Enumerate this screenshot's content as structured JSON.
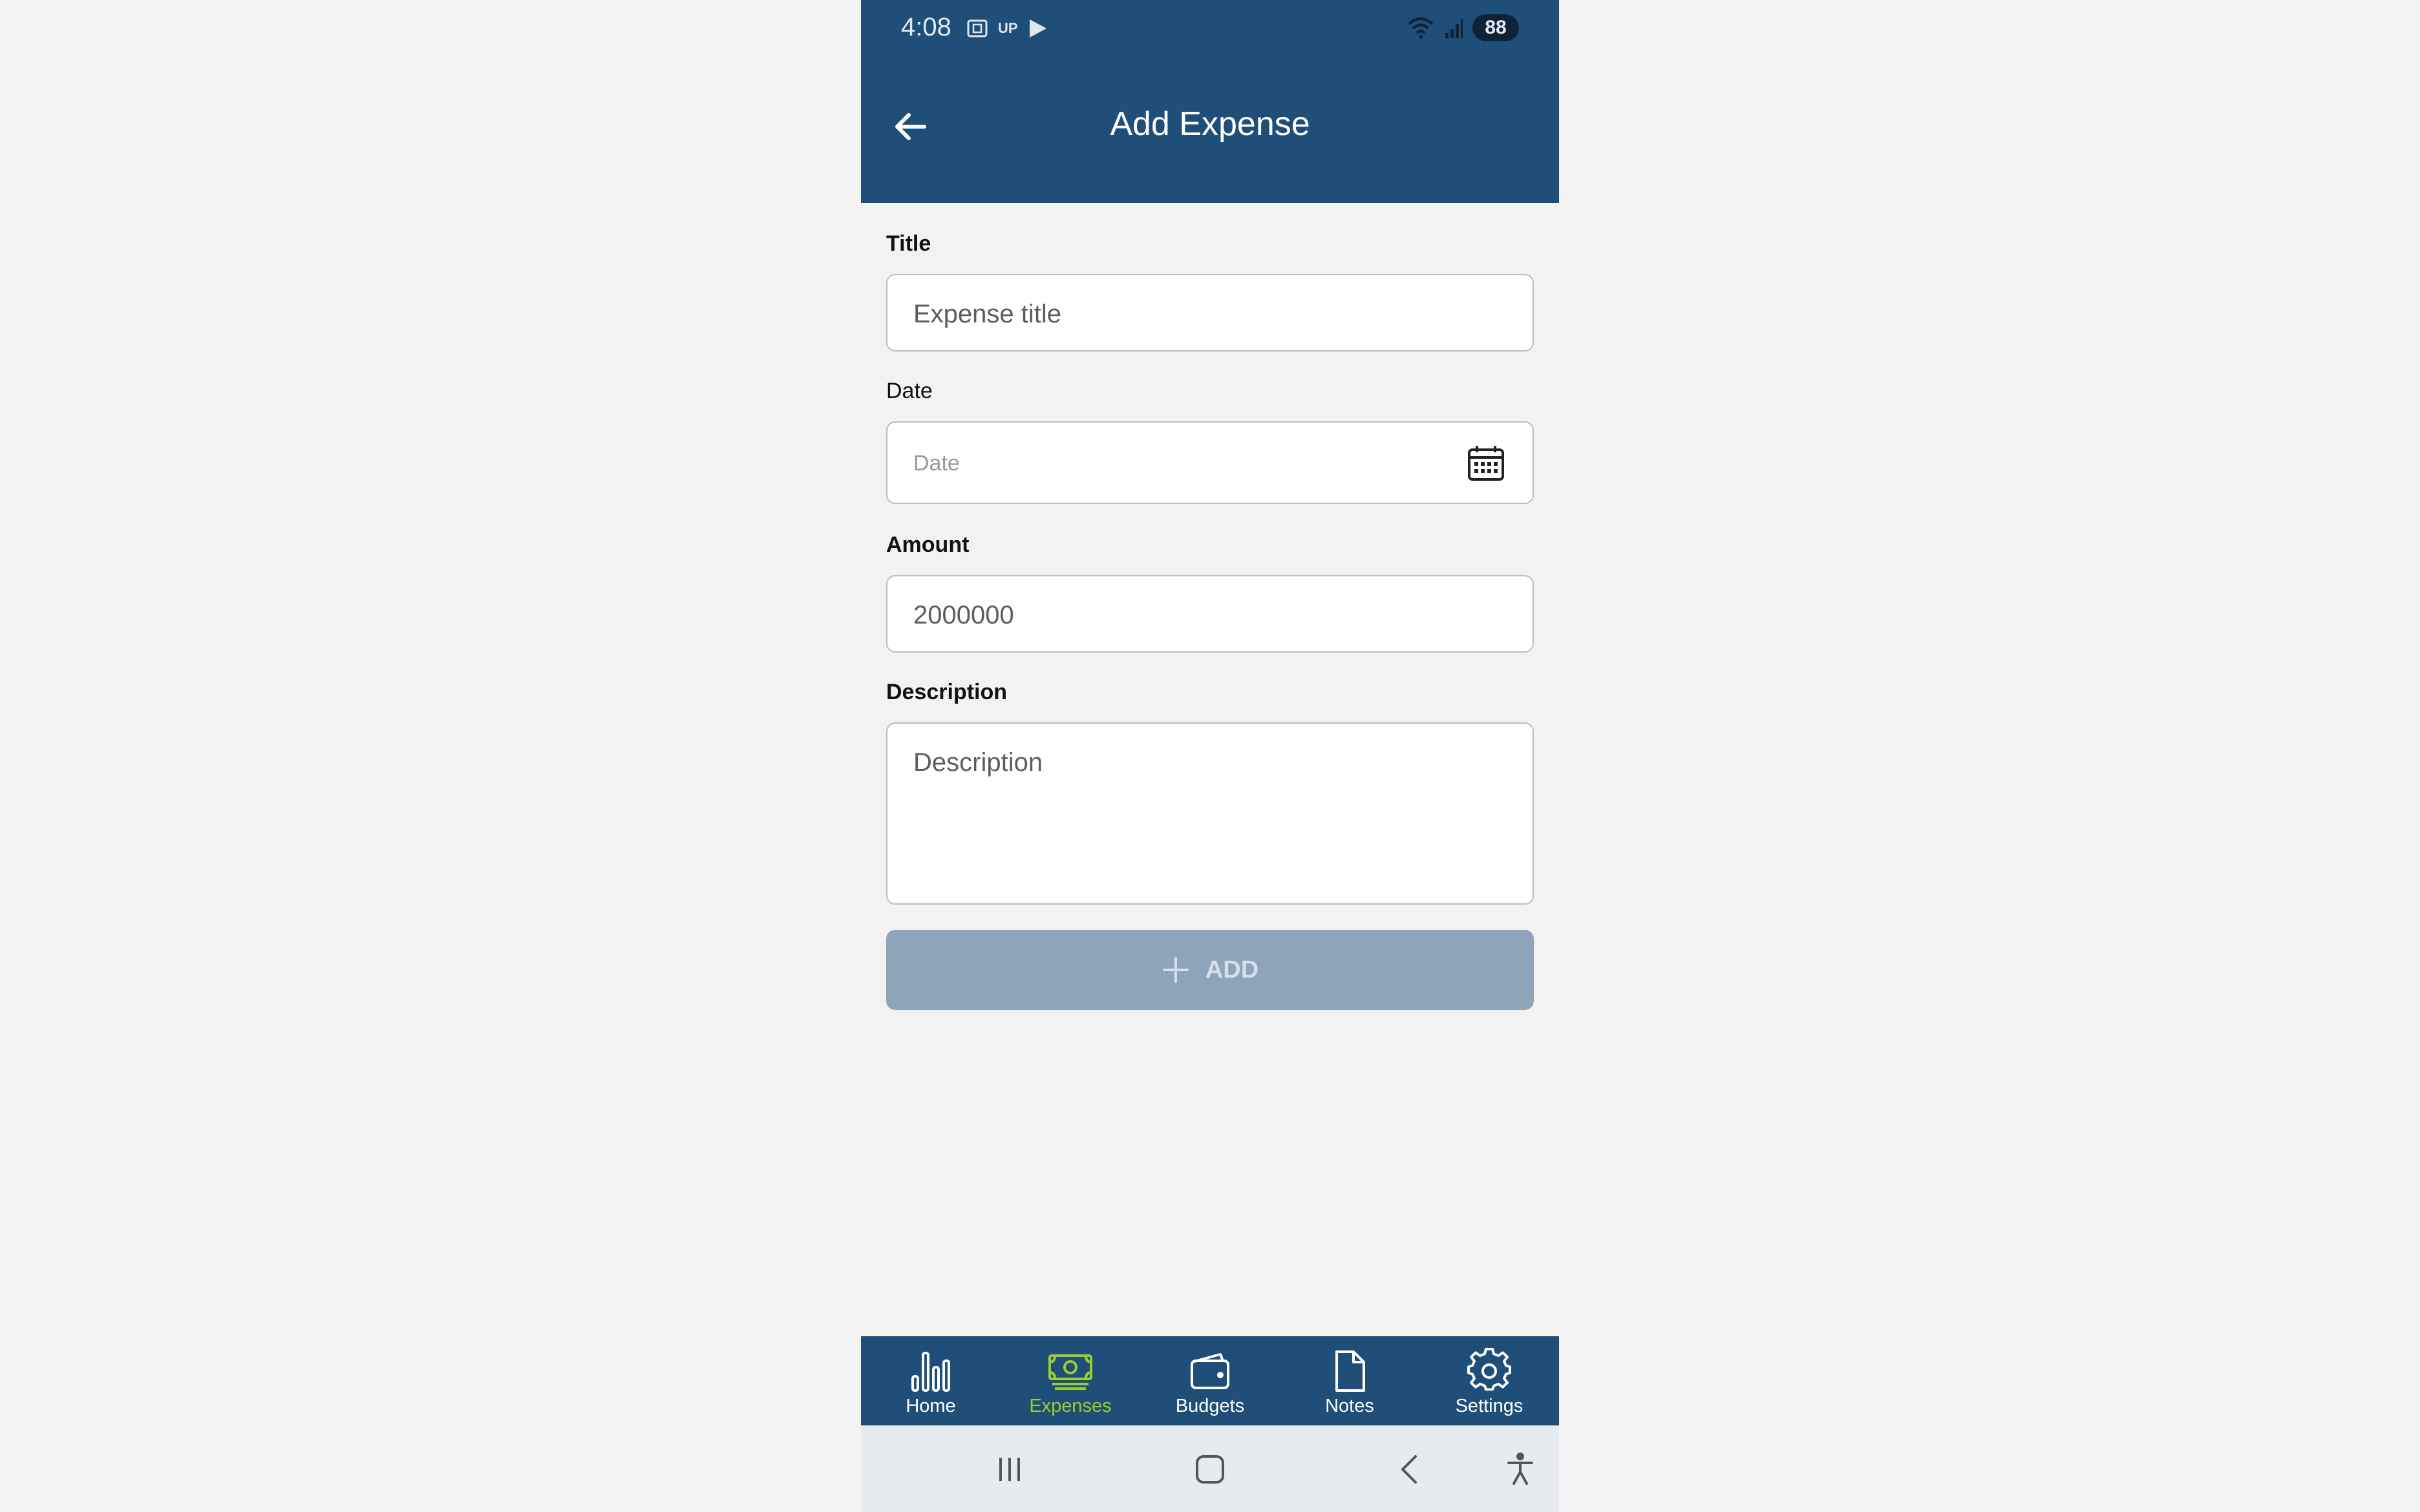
{
  "status": {
    "time": "4:08",
    "carrier_text": "UP",
    "battery": "88"
  },
  "header": {
    "title": "Add Expense"
  },
  "form": {
    "title": {
      "label": "Title",
      "placeholder": "Expense title"
    },
    "date": {
      "label": "Date",
      "placeholder": "Date"
    },
    "amount": {
      "label": "Amount",
      "value": "2000000"
    },
    "description": {
      "label": "Description",
      "placeholder": "Description"
    },
    "add_button": {
      "label": "ADD"
    }
  },
  "bottom_nav": {
    "items": [
      {
        "label": "Home",
        "icon": "bar-chart-icon"
      },
      {
        "label": "Expenses",
        "icon": "cash-icon",
        "active": true
      },
      {
        "label": "Budgets",
        "icon": "wallet-icon"
      },
      {
        "label": "Notes",
        "icon": "document-icon"
      },
      {
        "label": "Settings",
        "icon": "gear-icon"
      }
    ]
  },
  "colors": {
    "primary": "#1f4e79",
    "active_nav": "#9acd32",
    "button_disabled": "#8da4b9",
    "background": "#f2f2f2"
  }
}
